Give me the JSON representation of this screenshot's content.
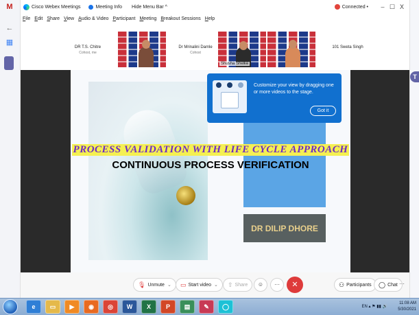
{
  "browser": {
    "gmail_tab_letter": "M"
  },
  "titlebar": {
    "app_name": "Cisco Webex Meetings",
    "meeting_info": "Meeting Info",
    "hide_menu": "Hide Menu Bar ^",
    "status": "Connected •",
    "min": "–",
    "max": "☐",
    "close": "X"
  },
  "menu": [
    "File",
    "Edit",
    "Share",
    "View",
    "Audio & Video",
    "Participant",
    "Meeting",
    "Breakout Sessions",
    "Help"
  ],
  "thumbnails": [
    {
      "name": "DR T.S. Chitre",
      "sub": "Cohost, me"
    },
    {
      "name": "Dr Mrinalini Damle",
      "sub": "Cohost"
    },
    {
      "name": "Shusha Shelke",
      "sub": ""
    },
    {
      "name": "101 Sweta Singh",
      "sub": ""
    }
  ],
  "slide": {
    "title_line1": "PROCESS VALIDATION WITH LIFE CYCLE APPROACH",
    "title_line2": "CONTINUOUS PROCESS VERIFICATION",
    "presenter": "DR DILIP DHORE"
  },
  "tooltip": {
    "message": "Customize your view by dragging one or more videos to the stage.",
    "button": "Got it"
  },
  "controls": {
    "unmute": "Unmute",
    "start_video": "Start video",
    "share": "Share",
    "more": "···",
    "end": "✕",
    "participants": "Participants",
    "chat": "Chat",
    "right_more": "···"
  },
  "taskbar": {
    "lang": "EN",
    "time": "11:08 AM",
    "date": "5/30/2021"
  },
  "colors": {
    "tooltip_bg": "#1170cf",
    "end_call": "#de3b3b",
    "slide_title_highlight": "#f5f052",
    "slide_title_text": "#6e2cc3",
    "slide_blue_panel": "#5ba5e5",
    "presenter_box": "#586060"
  }
}
